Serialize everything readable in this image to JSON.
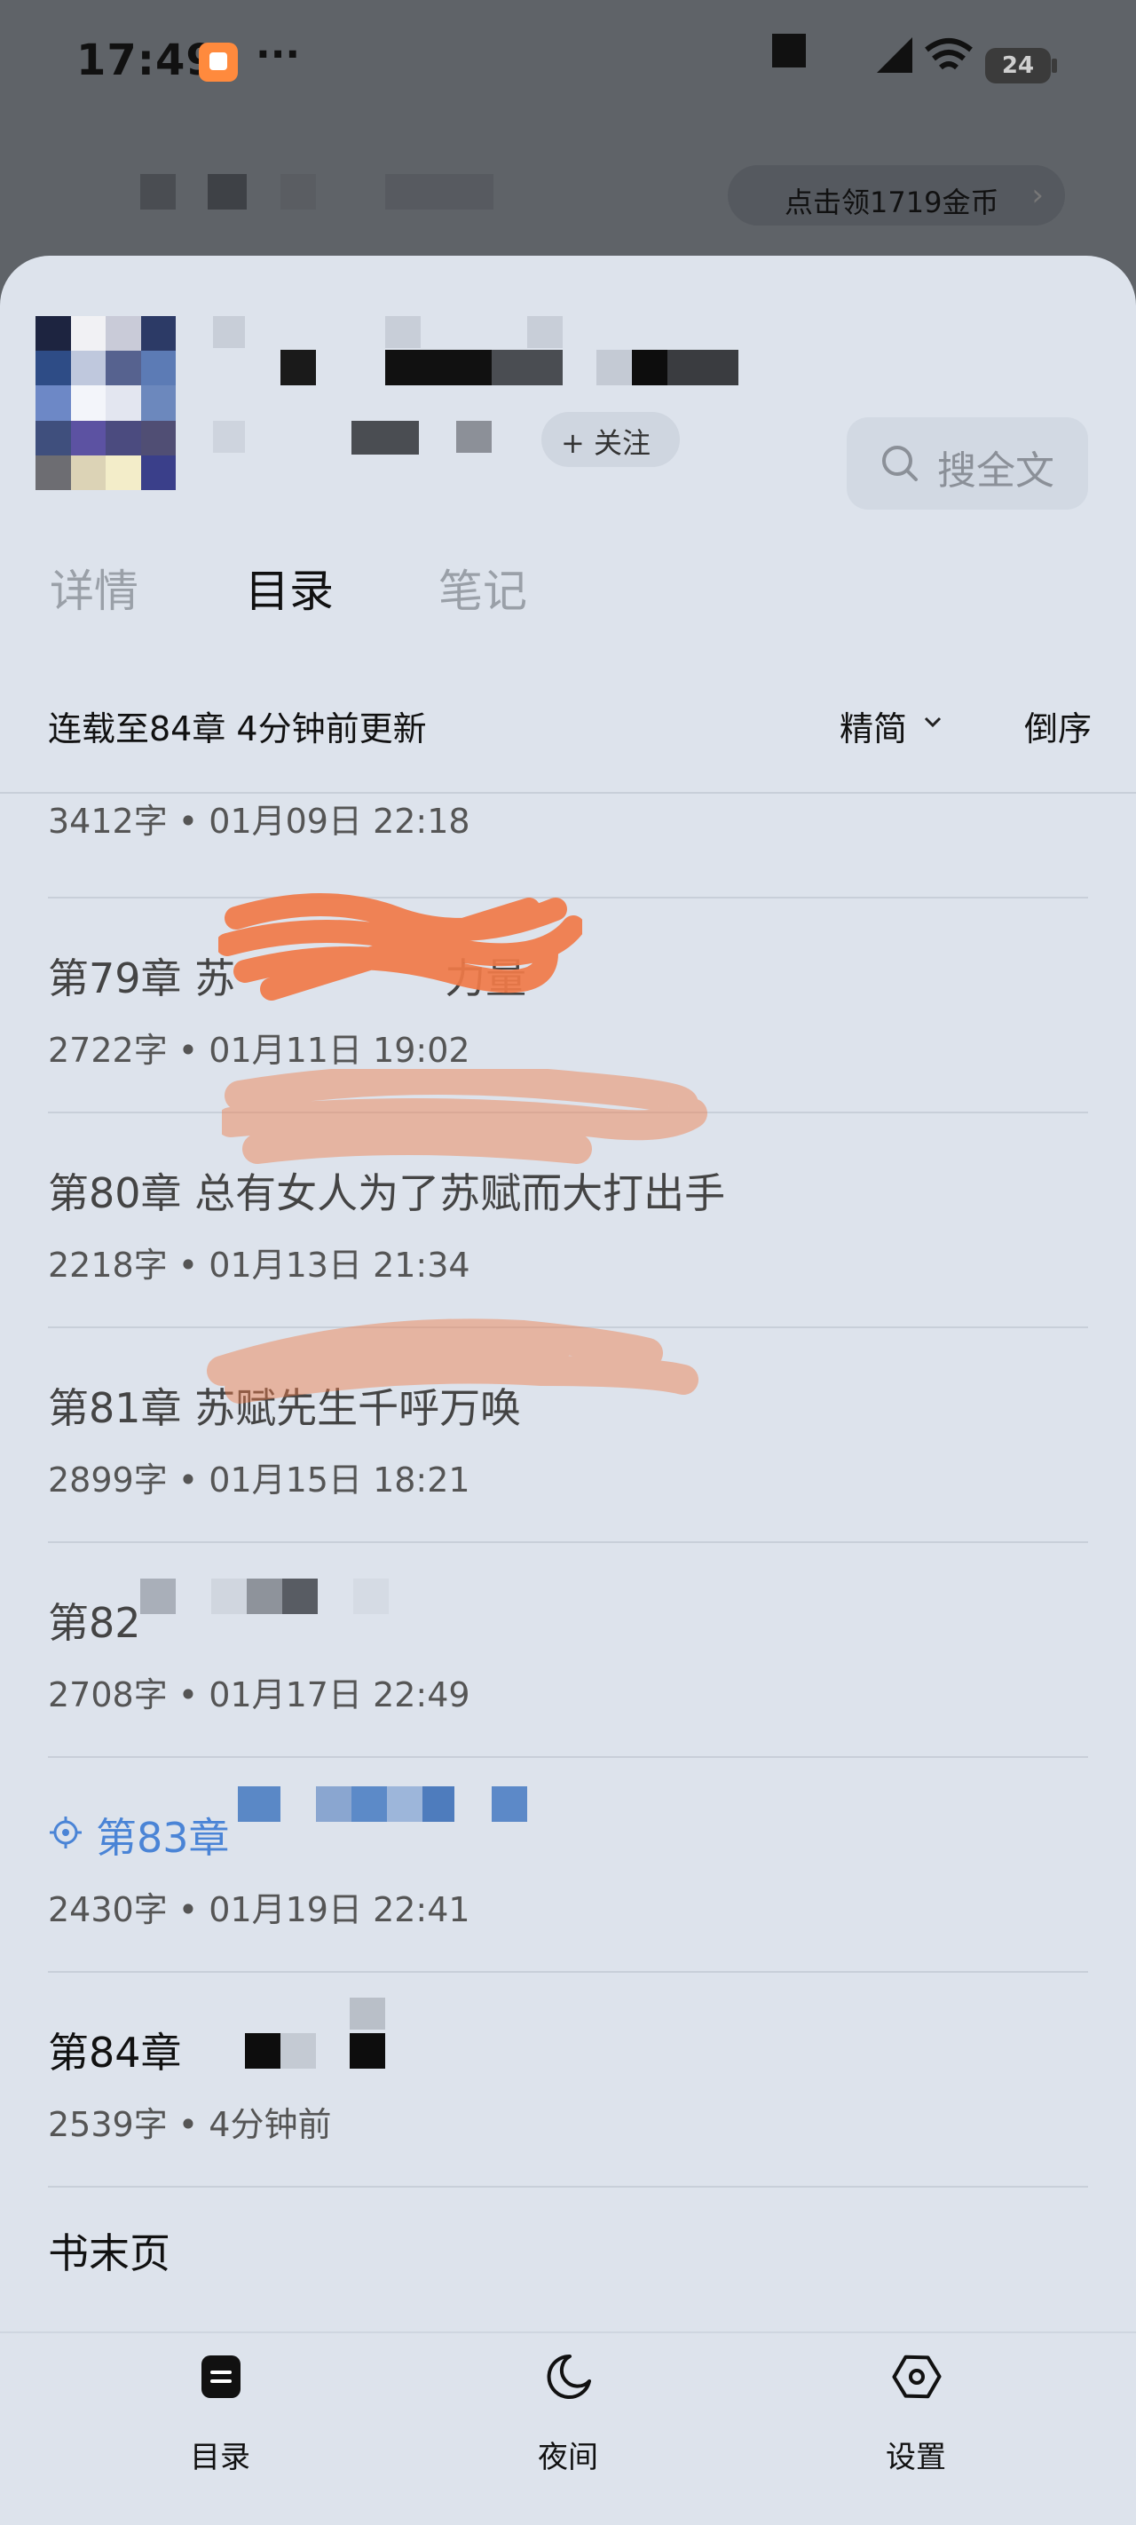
{
  "status_bar": {
    "time": "17:49",
    "menu_dots": "···",
    "battery": "24"
  },
  "banner": {
    "coin_text": "点击领1719金币",
    "arrow": "›"
  },
  "book_header": {
    "follow_label": "+ 关注",
    "search_label": "搜全文"
  },
  "tabs": [
    {
      "label": "详情"
    },
    {
      "label": "目录"
    },
    {
      "label": "笔记"
    }
  ],
  "info": {
    "status_text": "连载至84章 4分钟前更新",
    "mode_label": "精简",
    "sort_label": "倒序"
  },
  "chapters": [
    {
      "title": "",
      "meta": "3412字 • 01月09日 22:18"
    },
    {
      "title": "第79章 苏",
      "title_tail": "力量",
      "meta": "2722字 • 01月11日 19:02"
    },
    {
      "title": "第80章 总有女人为了苏赋而大打出手",
      "meta": "2218字 • 01月13日 21:34"
    },
    {
      "title": "第81章 苏赋先生千呼万唤",
      "meta": "2899字 • 01月15日 18:21"
    },
    {
      "title": "第82",
      "meta": "2708字 • 01月17日 22:49"
    },
    {
      "title": "第83章",
      "meta": "2430字 • 01月19日 22:41"
    },
    {
      "title": "第84章",
      "meta": "2539字 • 4分钟前"
    }
  ],
  "end_page": "书末页",
  "bottom_nav": [
    {
      "label": "目录",
      "icon": "catalog-icon"
    },
    {
      "label": "夜间",
      "icon": "moon-icon"
    },
    {
      "label": "设置",
      "icon": "settings-icon"
    }
  ],
  "colors": {
    "sheet_bg": "#dde3ec",
    "accent_blue": "#4a84d6",
    "scribble_orange": "#f07a48"
  }
}
